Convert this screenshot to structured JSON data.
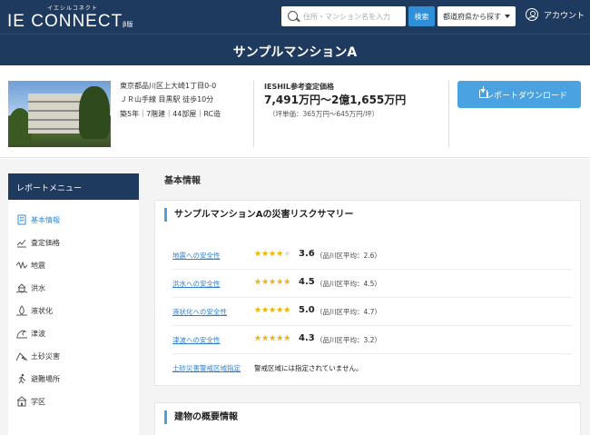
{
  "header": {
    "logo_sub": "イエシルコネクト",
    "logo_main": "IE CONNECT",
    "logo_beta": "β版",
    "search_placeholder": "住所・マンション名を入力",
    "search_button": "検索",
    "pref_button": "都道府県から探す",
    "account_label": "アカウント"
  },
  "title": "サンプルマンションA",
  "property": {
    "address": "東京都品川区上大崎1丁目0-0",
    "station": "ＪＲ山手線 目黒駅 徒歩10分",
    "details": "築5年｜7階建｜44部屋｜RC造",
    "price_label": "IESHIL参考査定価格",
    "price_value": "7,491万円〜2億1,655万円",
    "price_unit": "（坪単価：365万円〜645万円/坪）",
    "download_button": "レポートダウンロード"
  },
  "sidebar": {
    "heading": "レポートメニュー",
    "items": [
      {
        "label": "基本情報",
        "icon": "building-icon",
        "active": true
      },
      {
        "label": "査定価格",
        "icon": "chart-icon",
        "active": false
      },
      {
        "label": "地震",
        "icon": "earthquake-icon",
        "active": false
      },
      {
        "label": "洪水",
        "icon": "flood-icon",
        "active": false
      },
      {
        "label": "液状化",
        "icon": "liquefaction-icon",
        "active": false
      },
      {
        "label": "津波",
        "icon": "tsunami-icon",
        "active": false
      },
      {
        "label": "土砂災害",
        "icon": "landslide-icon",
        "active": false
      },
      {
        "label": "避難場所",
        "icon": "evacuation-icon",
        "active": false
      },
      {
        "label": "学区",
        "icon": "school-icon",
        "active": false
      }
    ]
  },
  "main": {
    "section_title": "基本情報",
    "risk_card_title": "サンプルマンションAの災害リスクサマリー",
    "risks": [
      {
        "label": "地震への安全性",
        "score": "3.6",
        "score_value": 3.6,
        "avg": "（品川区平均：2.6）"
      },
      {
        "label": "洪水への安全性",
        "score": "4.5",
        "score_value": 4.5,
        "avg": "（品川区平均：4.5）"
      },
      {
        "label": "液状化への安全性",
        "score": "5.0",
        "score_value": 5.0,
        "avg": "（品川区平均：4.7）"
      },
      {
        "label": "津波への安全性",
        "score": "4.3",
        "score_value": 4.3,
        "avg": "（品川区平均：3.2）"
      }
    ],
    "landslide": {
      "label": "土砂災害警戒区域指定",
      "value": "警戒区域には指定されていません。"
    },
    "building_card_title": "建物の概要情報"
  },
  "colors": {
    "navy": "#1e3a5f",
    "accent": "#4aa3e0",
    "star": "#f5b400",
    "link": "#2f7fd0"
  }
}
